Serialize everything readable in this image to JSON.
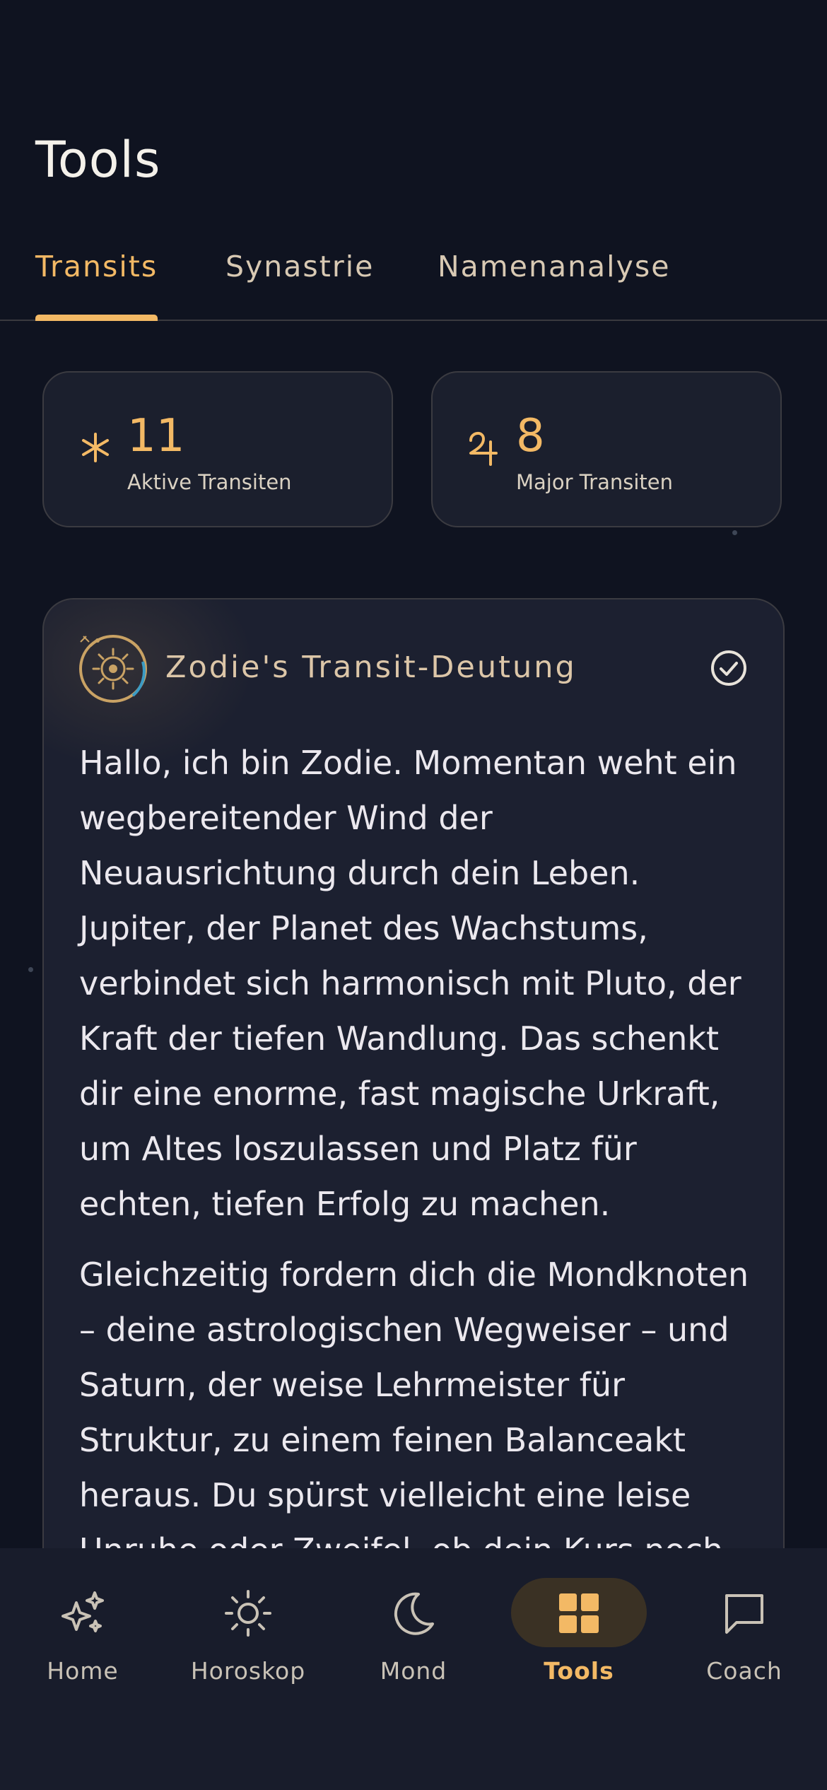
{
  "header": {
    "title": "Tools"
  },
  "tabs": [
    {
      "label": "Transits",
      "active": true
    },
    {
      "label": "Synastrie",
      "active": false
    },
    {
      "label": "Namenanalyse",
      "active": false
    }
  ],
  "stats": [
    {
      "icon": "sparkle-asterisk-icon",
      "value": "11",
      "label": "Aktive Transiten"
    },
    {
      "icon": "jupiter-symbol-icon",
      "value": "8",
      "label": "Major Transiten"
    }
  ],
  "transit_card": {
    "avatar_icon": "zodie-sun-emblem-icon",
    "title": "Zodie's Transit-Deutung",
    "status_icon": "check-circle-icon",
    "paragraphs": [
      "Hallo, ich bin Zodie. Momentan weht ein wegbereitender Wind der Neuausrichtung durch dein Leben. Jupiter, der Planet des Wachstums, verbindet sich harmonisch mit Pluto, der Kraft der tiefen Wandlung. Das schenkt dir eine enorme, fast magische Urkraft, um Altes loszulassen und Platz für echten, tiefen Erfolg zu machen.",
      "Gleichzeitig fordern dich die Mondknoten – deine astrologischen Wegweiser – und Saturn, der weise Lehrmeister für Struktur, zu einem feinen Balanceakt heraus. Du spürst vielleicht eine leise Unruhe oder Zweifel, ob dein Kurs noch zu deiner wahren Bestimmung passt."
    ]
  },
  "bottom_nav": [
    {
      "label": "Home",
      "icon": "sparkles-icon",
      "active": false
    },
    {
      "label": "Horoskop",
      "icon": "sun-icon",
      "active": false
    },
    {
      "label": "Mond",
      "icon": "moon-icon",
      "active": false
    },
    {
      "label": "Tools",
      "icon": "grid-icon",
      "active": true
    },
    {
      "label": "Coach",
      "icon": "chat-bubble-icon",
      "active": false
    }
  ],
  "colors": {
    "background": "#0f1320",
    "card": "#1c2030",
    "accent": "#f3b965",
    "text": "#ebe8ee",
    "nav_background": "#181c2b"
  }
}
